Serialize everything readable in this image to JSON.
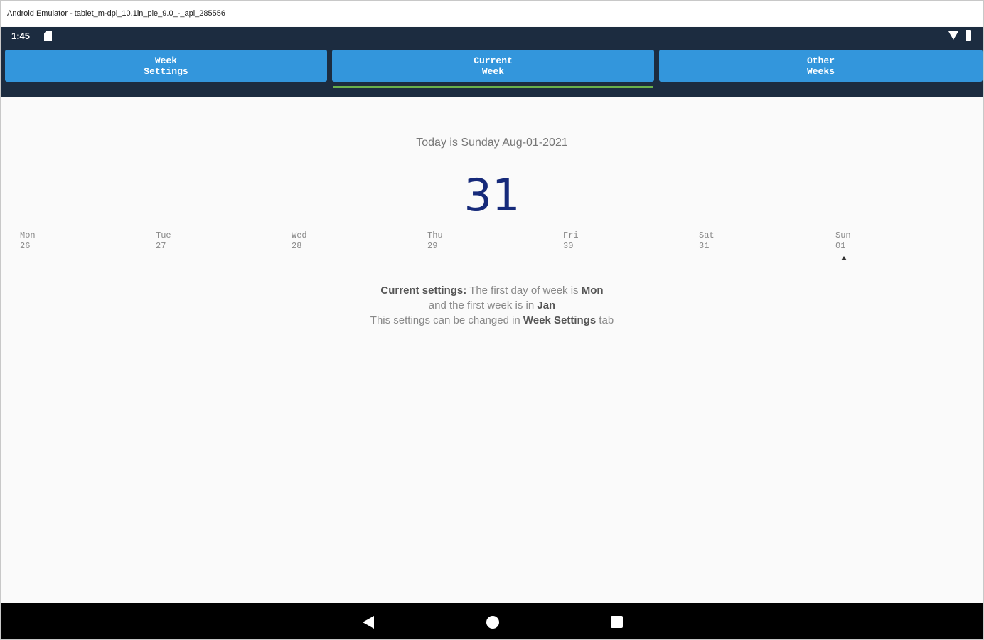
{
  "window": {
    "title": "Android Emulator - tablet_m-dpi_10.1in_pie_9.0_-_api_285556"
  },
  "status_bar": {
    "time": "1:45",
    "sd_icon": "sd-card-icon",
    "wifi_icon": "wifi-icon",
    "battery_icon": "battery-icon"
  },
  "tabs": [
    {
      "label": "Week\nSettings",
      "selected": false
    },
    {
      "label": "Current\nWeek",
      "selected": true
    },
    {
      "label": "Other\nWeeks",
      "selected": false
    }
  ],
  "main": {
    "today": "Today is Sunday Aug-01-2021",
    "week_number": "31",
    "days": [
      {
        "name": "Mon",
        "date": "26"
      },
      {
        "name": "Tue",
        "date": "27"
      },
      {
        "name": "Wed",
        "date": "28"
      },
      {
        "name": "Thu",
        "date": "29"
      },
      {
        "name": "Fri",
        "date": "30"
      },
      {
        "name": "Sat",
        "date": "31"
      },
      {
        "name": "Sun",
        "date": "01"
      }
    ],
    "settings": {
      "line1_bold1": "Current settings:",
      "line1_text": " The first day of week is ",
      "line1_bold2": "Mon",
      "line2_text": "and the first week is in ",
      "line2_bold": "Jan",
      "line3_text1": "This settings can be changed in ",
      "line3_bold": "Week Settings",
      "line3_text2": " tab"
    }
  },
  "colors": {
    "accent": "#3396dc",
    "header_bg": "#1c2c40",
    "indicator": "#6ab04c",
    "week_number": "#162a7a"
  },
  "nav": {
    "back_icon": "back-icon",
    "home_icon": "home-icon",
    "recents_icon": "recents-icon"
  }
}
